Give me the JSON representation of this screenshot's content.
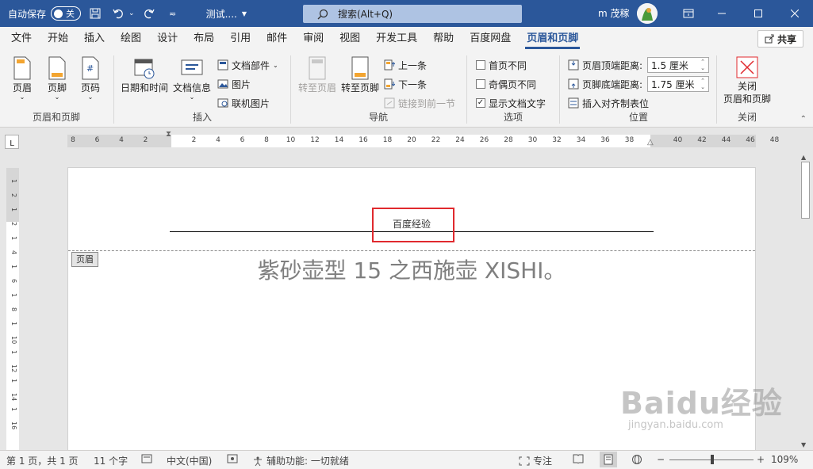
{
  "titlebar": {
    "autosave_label": "自动保存",
    "autosave_state": "关",
    "doc_title": "测试....",
    "search_placeholder": "搜索(Alt+Q)",
    "user_name": "m 茂稼"
  },
  "menu": {
    "tabs": [
      "文件",
      "开始",
      "插入",
      "绘图",
      "设计",
      "布局",
      "引用",
      "邮件",
      "审阅",
      "视图",
      "开发工具",
      "帮助",
      "百度网盘",
      "页眉和页脚"
    ],
    "active": "页眉和页脚",
    "share_label": "共享"
  },
  "ribbon": {
    "group1": {
      "label": "页眉和页脚",
      "header": "页眉",
      "footer": "页脚",
      "pagenum": "页码"
    },
    "group2": {
      "label": "插入",
      "datetime": "日期和时间",
      "docinfo": "文档信息",
      "docparts": "文档部件",
      "picture": "图片",
      "onlinepic": "联机图片"
    },
    "group3": {
      "label": "导航",
      "goto_header": "转至页眉",
      "goto_footer": "转至页脚",
      "prev": "上一条",
      "next": "下一条",
      "link_prev": "链接到前一节"
    },
    "group4": {
      "label": "选项",
      "first_page": "首页不同",
      "odd_even": "奇偶页不同",
      "show_text": "显示文档文字"
    },
    "group5": {
      "label": "位置",
      "header_dist_label": "页眉顶端距离:",
      "header_dist": "1.5 厘米",
      "footer_dist_label": "页脚底端距离:",
      "footer_dist": "1.75 厘米",
      "align_tab": "插入对齐制表位"
    },
    "group6": {
      "label": "关闭",
      "close": "关闭",
      "close2": "页眉和页脚"
    }
  },
  "ruler": {
    "numbers": [
      "8",
      "6",
      "4",
      "2",
      "",
      "2",
      "4",
      "6",
      "8",
      "10",
      "12",
      "14",
      "16",
      "18",
      "20",
      "22",
      "24",
      "26",
      "28",
      "30",
      "32",
      "34",
      "36",
      "38",
      "",
      "40",
      "42",
      "44",
      "46",
      "48"
    ],
    "vnumbers": [
      "1",
      "2",
      "1",
      "2",
      "1",
      "4",
      "1",
      "6",
      "1",
      "8",
      "1",
      "10",
      "1",
      "12",
      "1",
      "14",
      "1",
      "16"
    ]
  },
  "document": {
    "header_text": "百度经验",
    "header_tag": "页眉",
    "body_text": "紫砂壶型 15 之西施壶 XISHI。"
  },
  "watermark": {
    "main": "Baidu经验",
    "sub": "jingyan.baidu.com"
  },
  "status": {
    "page": "第 1 页，共 1 页",
    "words": "11 个字",
    "lang": "中文(中国)",
    "accessibility": "辅助功能: 一切就绪",
    "focus": "专注",
    "zoom": "109%"
  },
  "colors": {
    "brand": "#2b579a",
    "highlight_box": "#e0292e"
  }
}
